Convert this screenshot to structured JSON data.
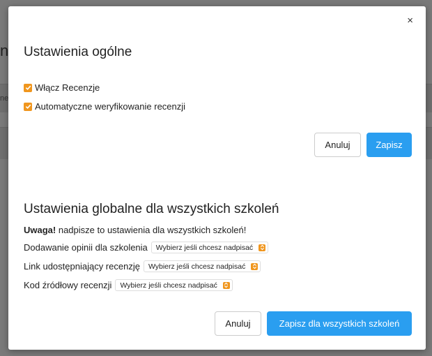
{
  "background": {
    "heading_fragment": "ni",
    "text_fragment": "ne s"
  },
  "modal": {
    "close_label": "×",
    "general": {
      "title": "Ustawienia ogólne",
      "checkboxes": [
        {
          "label": "Włącz Recenzje",
          "checked": true
        },
        {
          "label": "Automatyczne weryfikowanie recenzji",
          "checked": true
        }
      ],
      "cancel_label": "Anuluj",
      "save_label": "Zapisz"
    },
    "global": {
      "title": "Ustawienia globalne dla wszystkich szkoleń",
      "warning_bold": "Uwaga!",
      "warning_text": " nadpisze to ustawienia dla wszystkich szkoleń!",
      "settings": [
        {
          "label": "Dodawanie opinii dla szkolenia",
          "selected": "Wybierz jeśli chcesz nadpisać"
        },
        {
          "label": "Link udostępniający recenzję",
          "selected": "Wybierz jeśli chcesz nadpisać"
        },
        {
          "label": "Kod źródłowy recenzji",
          "selected": "Wybierz jeśli chcesz nadpisać"
        }
      ],
      "cancel_label": "Anuluj",
      "save_all_label": "Zapisz dla wszystkich szkoleń"
    },
    "colors": {
      "accent": "#2a9ef0",
      "checkbox": "#f0961e"
    }
  }
}
